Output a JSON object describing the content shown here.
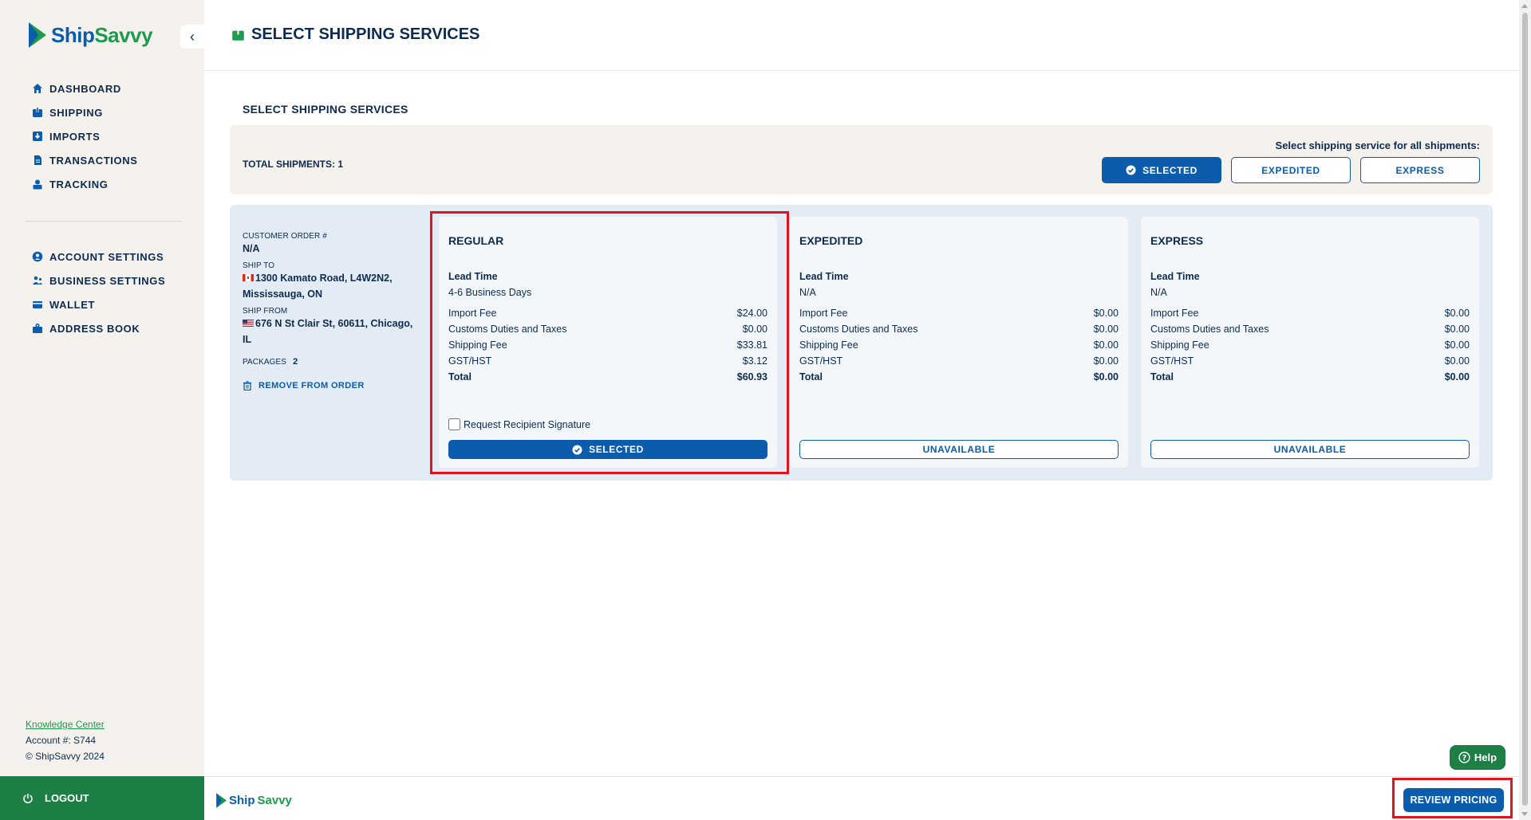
{
  "brand": {
    "name_part1": "Ship",
    "name_part2": "Savvy"
  },
  "sidebar": {
    "main_items": [
      {
        "label": "DASHBOARD",
        "icon": "home-icon"
      },
      {
        "label": "SHIPPING",
        "icon": "package-icon"
      },
      {
        "label": "IMPORTS",
        "icon": "import-icon"
      },
      {
        "label": "TRANSACTIONS",
        "icon": "document-icon"
      },
      {
        "label": "TRACKING",
        "icon": "tracking-icon"
      }
    ],
    "settings_items": [
      {
        "label": "ACCOUNT SETTINGS",
        "icon": "user-circle-icon"
      },
      {
        "label": "BUSINESS SETTINGS",
        "icon": "users-icon"
      },
      {
        "label": "WALLET",
        "icon": "wallet-icon"
      },
      {
        "label": "ADDRESS BOOK",
        "icon": "address-book-icon"
      }
    ],
    "knowledge_center": "Knowledge Center",
    "account": "Account #: S744",
    "copyright": "© ShipSavvy 2024",
    "logout": "LOGOUT"
  },
  "header": {
    "title": "SELECT SHIPPING SERVICES"
  },
  "section_title": "SELECT SHIPPING SERVICES",
  "total_bar": {
    "total_label": "TOTAL SHIPMENTS: 1",
    "all_label": "Select shipping service for all shipments:",
    "buttons": [
      "SELECTED",
      "EXPEDITED",
      "EXPRESS"
    ]
  },
  "shipment": {
    "customer_order_label": "CUSTOMER ORDER #",
    "customer_order_value": "N/A",
    "ship_to_label": "SHIP TO",
    "ship_to_value": "1300 Kamato Road, L4W2N2, Mississauga, ON",
    "ship_from_label": "SHIP FROM",
    "ship_from_value": "676 N St Clair St, 60611, Chicago, IL",
    "packages_label": "PACKAGES",
    "packages_value": "2",
    "remove_label": "REMOVE FROM ORDER"
  },
  "services": [
    {
      "name": "REGULAR",
      "lead_label": "Lead Time",
      "lead_value": "4-6 Business Days",
      "fees": [
        {
          "label": "Import Fee",
          "value": "$24.00"
        },
        {
          "label": "Customs Duties and Taxes",
          "value": "$0.00"
        },
        {
          "label": "Shipping Fee",
          "value": "$33.81"
        },
        {
          "label": "GST/HST",
          "value": "$3.12"
        },
        {
          "label": "Total",
          "value": "$60.93"
        }
      ],
      "signature_label": "Request Recipient Signature",
      "button": "SELECTED"
    },
    {
      "name": "EXPEDITED",
      "lead_label": "Lead Time",
      "lead_value": "N/A",
      "fees": [
        {
          "label": "Import Fee",
          "value": "$0.00"
        },
        {
          "label": "Customs Duties and Taxes",
          "value": "$0.00"
        },
        {
          "label": "Shipping Fee",
          "value": "$0.00"
        },
        {
          "label": "GST/HST",
          "value": "$0.00"
        },
        {
          "label": "Total",
          "value": "$0.00"
        }
      ],
      "button": "UNAVAILABLE"
    },
    {
      "name": "EXPRESS",
      "lead_label": "Lead Time",
      "lead_value": "N/A",
      "fees": [
        {
          "label": "Import Fee",
          "value": "$0.00"
        },
        {
          "label": "Customs Duties and Taxes",
          "value": "$0.00"
        },
        {
          "label": "Shipping Fee",
          "value": "$0.00"
        },
        {
          "label": "GST/HST",
          "value": "$0.00"
        },
        {
          "label": "Total",
          "value": "$0.00"
        }
      ],
      "button": "UNAVAILABLE"
    }
  ],
  "footer": {
    "help": "Help",
    "review_pricing": "REVIEW PRICING"
  },
  "colors": {
    "primary": "#0b5cad",
    "brand_green": "#1d7f46",
    "highlight": "#e0141e",
    "sidebar_bg": "#f5f2ee",
    "panel_bg": "#e3ecf5"
  }
}
